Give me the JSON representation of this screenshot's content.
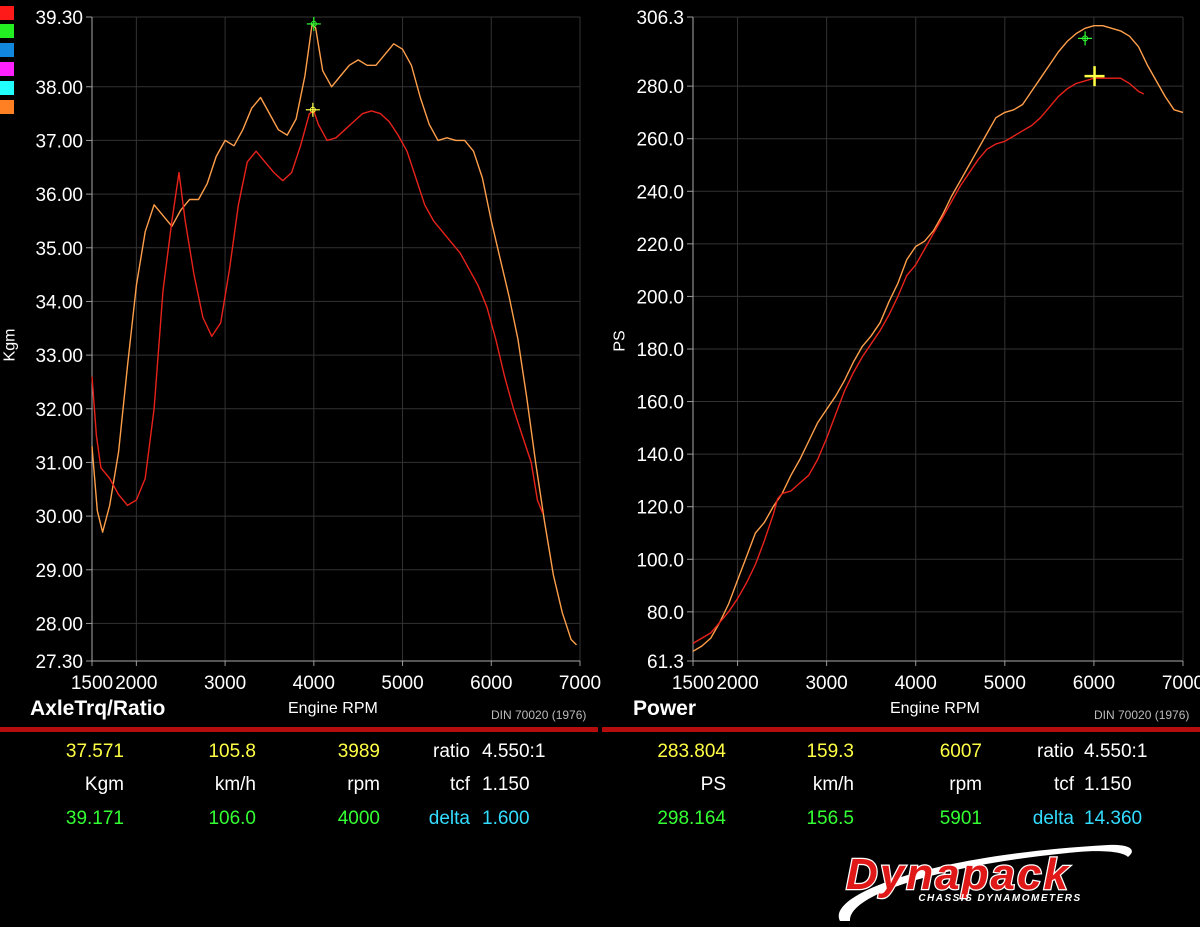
{
  "legend_colors": [
    "#ff1a1a",
    "#22ee22",
    "#1188dd",
    "#ff22ff",
    "#22ffff",
    "#ff8022"
  ],
  "colors": {
    "run_red": "#e8221a",
    "run_orange": "#ff9f4a",
    "grid": "#333333",
    "yellow": "#ffff44",
    "green": "#33ff33",
    "cyan": "#33ddff",
    "separator": "#b50d0d"
  },
  "chart_data": [
    {
      "type": "line",
      "title": "AxleTrq/Ratio",
      "xlabel": "Engine RPM",
      "ylabel": "Kgm",
      "standard": "DIN 70020 (1976)",
      "xlim": [
        1500,
        7000
      ],
      "ylim": [
        27.3,
        39.3
      ],
      "x_ticks": [
        1500,
        2000,
        3000,
        4000,
        5000,
        6000,
        7000
      ],
      "y_ticks": [
        "27.30",
        "28.00",
        "29.00",
        "30.00",
        "31.00",
        "32.00",
        "33.00",
        "34.00",
        "35.00",
        "36.00",
        "37.00",
        "38.00",
        "39.30"
      ],
      "grid": true,
      "series": [
        {
          "color": "#ff9f4a",
          "points": [
            [
              1500,
              31.3
            ],
            [
              1560,
              30.1
            ],
            [
              1620,
              29.7
            ],
            [
              1700,
              30.2
            ],
            [
              1800,
              31.2
            ],
            [
              1900,
              32.8
            ],
            [
              2000,
              34.3
            ],
            [
              2100,
              35.3
            ],
            [
              2200,
              35.8
            ],
            [
              2300,
              35.6
            ],
            [
              2400,
              35.4
            ],
            [
              2500,
              35.7
            ],
            [
              2600,
              35.9
            ],
            [
              2700,
              35.9
            ],
            [
              2800,
              36.2
            ],
            [
              2900,
              36.7
            ],
            [
              3000,
              37.0
            ],
            [
              3100,
              36.9
            ],
            [
              3200,
              37.2
            ],
            [
              3300,
              37.6
            ],
            [
              3400,
              37.8
            ],
            [
              3500,
              37.5
            ],
            [
              3600,
              37.2
            ],
            [
              3700,
              37.1
            ],
            [
              3800,
              37.4
            ],
            [
              3900,
              38.2
            ],
            [
              3980,
              39.15
            ],
            [
              4020,
              39.1
            ],
            [
              4100,
              38.3
            ],
            [
              4200,
              38.0
            ],
            [
              4300,
              38.2
            ],
            [
              4400,
              38.4
            ],
            [
              4500,
              38.5
            ],
            [
              4600,
              38.4
            ],
            [
              4700,
              38.4
            ],
            [
              4800,
              38.6
            ],
            [
              4900,
              38.8
            ],
            [
              5000,
              38.7
            ],
            [
              5100,
              38.4
            ],
            [
              5200,
              37.8
            ],
            [
              5300,
              37.3
            ],
            [
              5400,
              37.0
            ],
            [
              5500,
              37.05
            ],
            [
              5600,
              37.0
            ],
            [
              5700,
              37.0
            ],
            [
              5800,
              36.8
            ],
            [
              5900,
              36.3
            ],
            [
              6000,
              35.5
            ],
            [
              6100,
              34.8
            ],
            [
              6200,
              34.1
            ],
            [
              6300,
              33.3
            ],
            [
              6400,
              32.2
            ],
            [
              6500,
              31.0
            ],
            [
              6600,
              29.9
            ],
            [
              6700,
              28.9
            ],
            [
              6800,
              28.2
            ],
            [
              6900,
              27.7
            ],
            [
              6960,
              27.6
            ]
          ]
        },
        {
          "color": "#e8221a",
          "points": [
            [
              1500,
              32.6
            ],
            [
              1550,
              31.5
            ],
            [
              1600,
              30.9
            ],
            [
              1700,
              30.7
            ],
            [
              1800,
              30.4
            ],
            [
              1900,
              30.2
            ],
            [
              2000,
              30.3
            ],
            [
              2100,
              30.7
            ],
            [
              2200,
              32.0
            ],
            [
              2300,
              34.2
            ],
            [
              2400,
              35.5
            ],
            [
              2480,
              36.4
            ],
            [
              2550,
              35.5
            ],
            [
              2650,
              34.5
            ],
            [
              2750,
              33.7
            ],
            [
              2850,
              33.35
            ],
            [
              2950,
              33.6
            ],
            [
              3050,
              34.6
            ],
            [
              3150,
              35.8
            ],
            [
              3250,
              36.6
            ],
            [
              3350,
              36.8
            ],
            [
              3450,
              36.6
            ],
            [
              3550,
              36.4
            ],
            [
              3650,
              36.25
            ],
            [
              3750,
              36.4
            ],
            [
              3850,
              36.9
            ],
            [
              3950,
              37.5
            ],
            [
              4000,
              37.55
            ],
            [
              4050,
              37.3
            ],
            [
              4150,
              37.0
            ],
            [
              4250,
              37.05
            ],
            [
              4350,
              37.2
            ],
            [
              4450,
              37.35
            ],
            [
              4550,
              37.5
            ],
            [
              4650,
              37.55
            ],
            [
              4750,
              37.5
            ],
            [
              4850,
              37.35
            ],
            [
              4950,
              37.1
            ],
            [
              5050,
              36.8
            ],
            [
              5150,
              36.3
            ],
            [
              5250,
              35.8
            ],
            [
              5350,
              35.5
            ],
            [
              5450,
              35.3
            ],
            [
              5550,
              35.1
            ],
            [
              5650,
              34.9
            ],
            [
              5750,
              34.6
            ],
            [
              5850,
              34.3
            ],
            [
              5950,
              33.9
            ],
            [
              6050,
              33.3
            ],
            [
              6150,
              32.6
            ],
            [
              6250,
              32.0
            ],
            [
              6350,
              31.5
            ],
            [
              6450,
              31.0
            ],
            [
              6520,
              30.3
            ],
            [
              6580,
              30.05
            ]
          ]
        }
      ],
      "cursor_points": [
        [
          4000,
          39.171
        ],
        [
          3989,
          37.571
        ]
      ]
    },
    {
      "type": "line",
      "title": "Power",
      "xlabel": "Engine RPM",
      "ylabel": "PS",
      "standard": "DIN 70020 (1976)",
      "xlim": [
        1500,
        7000
      ],
      "ylim": [
        61.3,
        306.3
      ],
      "x_ticks": [
        1500,
        2000,
        3000,
        4000,
        5000,
        6000,
        7000
      ],
      "y_ticks": [
        "61.3",
        "80.0",
        "100.0",
        "120.0",
        "140.0",
        "160.0",
        "180.0",
        "200.0",
        "220.0",
        "240.0",
        "260.0",
        "280.0",
        "306.3"
      ],
      "grid": true,
      "series": [
        {
          "color": "#ff9f4a",
          "points": [
            [
              1500,
              65
            ],
            [
              1600,
              67
            ],
            [
              1700,
              70
            ],
            [
              1800,
              76
            ],
            [
              1900,
              83
            ],
            [
              2000,
              92
            ],
            [
              2100,
              101
            ],
            [
              2200,
              110
            ],
            [
              2300,
              114
            ],
            [
              2400,
              120
            ],
            [
              2500,
              125
            ],
            [
              2600,
              132
            ],
            [
              2700,
              138
            ],
            [
              2800,
              145
            ],
            [
              2900,
              152
            ],
            [
              3000,
              157
            ],
            [
              3100,
              162
            ],
            [
              3200,
              168
            ],
            [
              3300,
              175
            ],
            [
              3400,
              181
            ],
            [
              3500,
              185
            ],
            [
              3600,
              190
            ],
            [
              3700,
              198
            ],
            [
              3800,
              205
            ],
            [
              3900,
              214
            ],
            [
              4000,
              219
            ],
            [
              4100,
              221
            ],
            [
              4200,
              225
            ],
            [
              4300,
              231
            ],
            [
              4400,
              238
            ],
            [
              4500,
              244
            ],
            [
              4600,
              250
            ],
            [
              4700,
              256
            ],
            [
              4800,
              262
            ],
            [
              4900,
              268
            ],
            [
              5000,
              270
            ],
            [
              5100,
              271
            ],
            [
              5200,
              273
            ],
            [
              5300,
              278
            ],
            [
              5400,
              283
            ],
            [
              5500,
              288
            ],
            [
              5600,
              293
            ],
            [
              5700,
              297
            ],
            [
              5800,
              300
            ],
            [
              5900,
              302
            ],
            [
              6000,
              303
            ],
            [
              6100,
              303
            ],
            [
              6200,
              302
            ],
            [
              6300,
              301
            ],
            [
              6400,
              299
            ],
            [
              6500,
              295
            ],
            [
              6600,
              288
            ],
            [
              6700,
              282
            ],
            [
              6800,
              276
            ],
            [
              6900,
              271
            ],
            [
              7000,
              270
            ]
          ]
        },
        {
          "color": "#e8221a",
          "points": [
            [
              1500,
              68
            ],
            [
              1600,
              70
            ],
            [
              1700,
              72
            ],
            [
              1800,
              76
            ],
            [
              1900,
              80
            ],
            [
              2000,
              85
            ],
            [
              2100,
              91
            ],
            [
              2200,
              98
            ],
            [
              2300,
              107
            ],
            [
              2400,
              117
            ],
            [
              2450,
              123
            ],
            [
              2500,
              125
            ],
            [
              2600,
              126
            ],
            [
              2700,
              129
            ],
            [
              2800,
              132
            ],
            [
              2900,
              138
            ],
            [
              3000,
              146
            ],
            [
              3100,
              155
            ],
            [
              3200,
              164
            ],
            [
              3300,
              171
            ],
            [
              3400,
              177
            ],
            [
              3500,
              182
            ],
            [
              3600,
              187
            ],
            [
              3700,
              193
            ],
            [
              3800,
              200
            ],
            [
              3900,
              208
            ],
            [
              4000,
              212
            ],
            [
              4100,
              218
            ],
            [
              4200,
              224
            ],
            [
              4300,
              230
            ],
            [
              4400,
              236
            ],
            [
              4500,
              242
            ],
            [
              4600,
              247
            ],
            [
              4700,
              252
            ],
            [
              4800,
              256
            ],
            [
              4900,
              258
            ],
            [
              5000,
              259
            ],
            [
              5100,
              261
            ],
            [
              5200,
              263
            ],
            [
              5300,
              265
            ],
            [
              5400,
              268
            ],
            [
              5500,
              272
            ],
            [
              5600,
              276
            ],
            [
              5700,
              279
            ],
            [
              5800,
              281
            ],
            [
              5900,
              282
            ],
            [
              6000,
              283
            ],
            [
              6100,
              283
            ],
            [
              6200,
              283
            ],
            [
              6300,
              283
            ],
            [
              6400,
              281
            ],
            [
              6500,
              278
            ],
            [
              6560,
              277
            ]
          ]
        }
      ],
      "cursor_points": [
        [
          5901,
          298.164
        ],
        [
          6007,
          283.804
        ]
      ]
    }
  ],
  "readouts": {
    "left": {
      "row1": [
        "37.571",
        "105.8",
        "3989",
        "4.550:1"
      ],
      "row2": [
        "Kgm",
        "km/h",
        "rpm",
        "1.150"
      ],
      "row3": [
        "39.171",
        "106.0",
        "4000",
        "1.600"
      ],
      "ratio_label": "ratio",
      "tcf_label": "tcf",
      "delta_label": "delta"
    },
    "right": {
      "row1": [
        "283.804",
        "159.3",
        "6007",
        "4.550:1"
      ],
      "row2": [
        "PS",
        "km/h",
        "rpm",
        "1.150"
      ],
      "row3": [
        "298.164",
        "156.5",
        "5901",
        "14.360"
      ],
      "ratio_label": "ratio",
      "tcf_label": "tcf",
      "delta_label": "delta"
    }
  },
  "logo": {
    "brand": "Dynapack",
    "tagline": "CHASSIS DYNAMOMETERS"
  }
}
